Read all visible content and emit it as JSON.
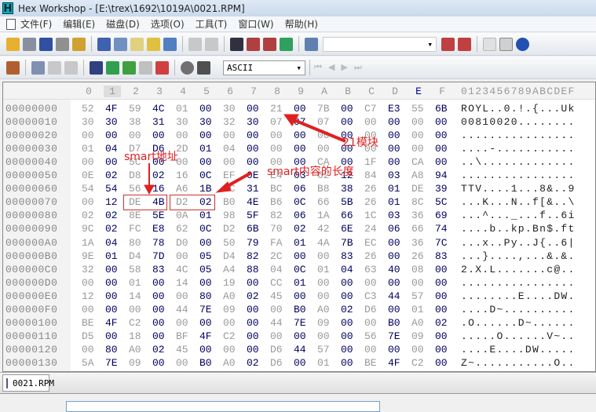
{
  "window": {
    "title": "Hex Workshop - [E:\\trex\\1692\\1019A\\0021.RPM]",
    "app_icon": "H"
  },
  "menu": [
    "文件(F)",
    "编辑(E)",
    "磁盘(D)",
    "选项(O)",
    "工具(T)",
    "窗口(W)",
    "帮助(H)"
  ],
  "toolbar2": {
    "type_select": "ASCII"
  },
  "hex_header": {
    "columns": [
      "0",
      "1",
      "2",
      "3",
      "4",
      "5",
      "6",
      "7",
      "8",
      "9",
      "A",
      "B",
      "C",
      "D",
      "E",
      "F"
    ],
    "ascii_header": "0123456789ABCDEF"
  },
  "rows": [
    {
      "offset": "00000000",
      "bytes": "52 4F 59 4C 01 00 30 00 21 00 7B 00 C7 E3 55 6B",
      "ascii": "ROYL..0.!.{...Uk"
    },
    {
      "offset": "00000010",
      "bytes": "30 30 38 31 30 30 32 30 07 07 07 00 00 00 00 00",
      "ascii": "00810020........"
    },
    {
      "offset": "00000020",
      "bytes": "00 00 00 00 00 00 00 00 00 00 00 00 00 00 00 00",
      "ascii": "................"
    },
    {
      "offset": "00000030",
      "bytes": "01 04 D7 D6 2D 01 04 00 00 00 00 00 00 00 00 00",
      "ascii": "....-..........."
    },
    {
      "offset": "00000040",
      "bytes": "00 00 5C 00 00 00 00 00 00 00 CA 00 1F 00 CA 00",
      "ascii": "..\\............."
    },
    {
      "offset": "00000050",
      "bytes": "0E 02 D8 02 16 0C EF 0E E4 03 62 12 84 03 A8 94",
      "ascii": "................"
    },
    {
      "offset": "00000060",
      "bytes": "54 54 56 16 A6 1B EC 31 BC 06 B8 38 26 01 DE 39",
      "ascii": "TTV....1...8&..9"
    },
    {
      "offset": "00000070",
      "bytes": "00 12 DE 4B D2 02 B0 4E B6 0C 66 5B 26 01 8C 5C",
      "ascii": "...K...N..f[&..\\"
    },
    {
      "offset": "00000080",
      "bytes": "02 02 8E 5E 0A 01 98 5F 82 06 1A 66 1C 03 36 69",
      "ascii": "...^..._...f..6i"
    },
    {
      "offset": "00000090",
      "bytes": "9C 02 FC E8 62 0C D2 6B 70 02 42 6E 24 06 66 74",
      "ascii": "....b..kp.Bn$.ft"
    },
    {
      "offset": "000000A0",
      "bytes": "1A 04 80 78 D0 00 50 79 FA 01 4A 7B EC 00 36 7C",
      "ascii": "...x..Py..J{..6|"
    },
    {
      "offset": "000000B0",
      "bytes": "9E 01 D4 7D 00 05 D4 82 2C 00 00 83 26 00 26 83",
      "ascii": "...}....,...&.&."
    },
    {
      "offset": "000000C0",
      "bytes": "32 00 58 83 4C 05 A4 88 04 0C 01 04 63 40 08 00",
      "ascii": "2.X.L.......c@.."
    },
    {
      "offset": "000000D0",
      "bytes": "00 00 01 00 14 00 19 00 CC 01 00 00 00 00 00 00",
      "ascii": "................"
    },
    {
      "offset": "000000E0",
      "bytes": "12 00 14 00 00 80 A0 02 45 00 00 00 C3 44 57 00",
      "ascii": "........E....DW."
    },
    {
      "offset": "000000F0",
      "bytes": "00 00 00 00 44 7E 09 00 00 B0 A0 02 D6 00 01 00",
      "ascii": "....D~.........."
    },
    {
      "offset": "00000100",
      "bytes": "BE 4F C2 00 00 00 00 00 44 7E 09 00 00 B0 A0 02",
      "ascii": ".O......D~......"
    },
    {
      "offset": "00000110",
      "bytes": "D5 00 18 00 BF 4F C2 00 00 00 00 00 56 7E 09 00",
      "ascii": ".....O......V~.."
    },
    {
      "offset": "00000120",
      "bytes": "00 80 A0 02 45 00 00 00 D6 44 57 00 00 00 00 00",
      "ascii": "....E....DW....."
    },
    {
      "offset": "00000130",
      "bytes": "5A 7E 09 00 00 B0 A0 02 D6 00 01 00 BE 4F C2 00",
      "ascii": "Z~...........O.."
    }
  ],
  "annotations": {
    "smart_address": "smart地址",
    "smart_length": "smart内容的长度",
    "module_21": "21模块"
  },
  "tabs": [
    {
      "label": "0021.RPM"
    }
  ],
  "colors": {
    "annotation": "#e02020",
    "odd_byte": "#000060",
    "even_byte": "#999999"
  }
}
